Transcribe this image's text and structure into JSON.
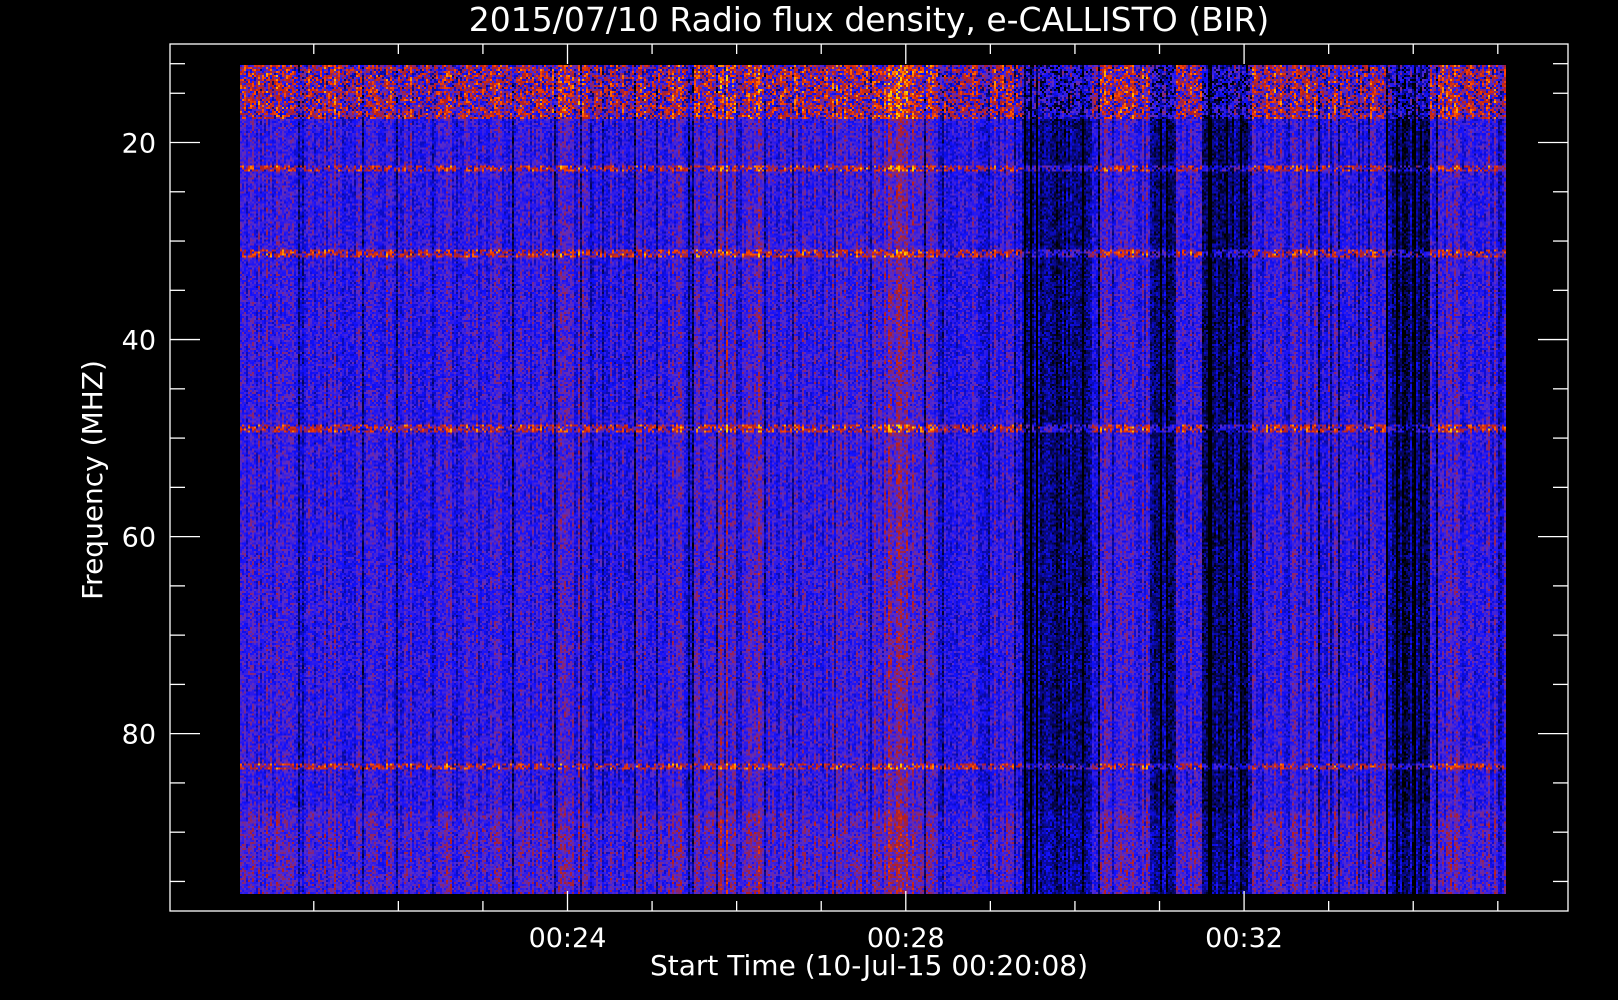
{
  "chart_data": {
    "type": "heatmap",
    "title": "2015/07/10  Radio flux density, e-CALLISTO (BIR)",
    "xlabel": "Start Time (10-Jul-15 00:20:08)",
    "ylabel": "Frequency (MHZ)",
    "x_axis": {
      "unit": "minutes after 00:20",
      "range": [
        19.3,
        35.83
      ],
      "data_range": [
        20.13,
        35.1
      ],
      "major_ticks": [
        {
          "value": 24,
          "label": "00:24"
        },
        {
          "value": 28,
          "label": "00:28"
        },
        {
          "value": 32,
          "label": "00:32"
        }
      ],
      "minor_ticks": [
        21,
        22,
        23,
        25,
        26,
        27,
        29,
        30,
        31,
        33,
        34,
        35
      ]
    },
    "y_axis": {
      "unit": "MHz",
      "inverted": true,
      "range": [
        10,
        98
      ],
      "data_range": [
        12.1,
        96.3
      ],
      "major_ticks": [
        {
          "value": 20,
          "label": "20"
        },
        {
          "value": 40,
          "label": "40"
        },
        {
          "value": 60,
          "label": "60"
        },
        {
          "value": 80,
          "label": "80"
        }
      ],
      "minor_ticks": [
        12,
        15,
        25,
        30,
        35,
        45,
        50,
        55,
        65,
        70,
        75,
        85,
        90,
        95
      ]
    },
    "colormap": [
      "#000000",
      "#1010ff",
      "#5a2cc8",
      "#b41e1e",
      "#ff4a00",
      "#ffd000"
    ],
    "features": {
      "bright_band_top_mhz": [
        12.1,
        17.5
      ],
      "interference_lines_mhz": [
        22.5,
        31.2,
        49.0,
        83.4
      ],
      "dark_columns_minutes": [
        [
          29.4,
          30.2
        ],
        [
          30.9,
          31.2
        ],
        [
          31.5,
          32.1
        ],
        [
          33.7,
          34.2
        ]
      ],
      "reddish_columns_minutes": [
        [
          25.8,
          26.3
        ],
        [
          27.6,
          28.1
        ]
      ]
    }
  }
}
